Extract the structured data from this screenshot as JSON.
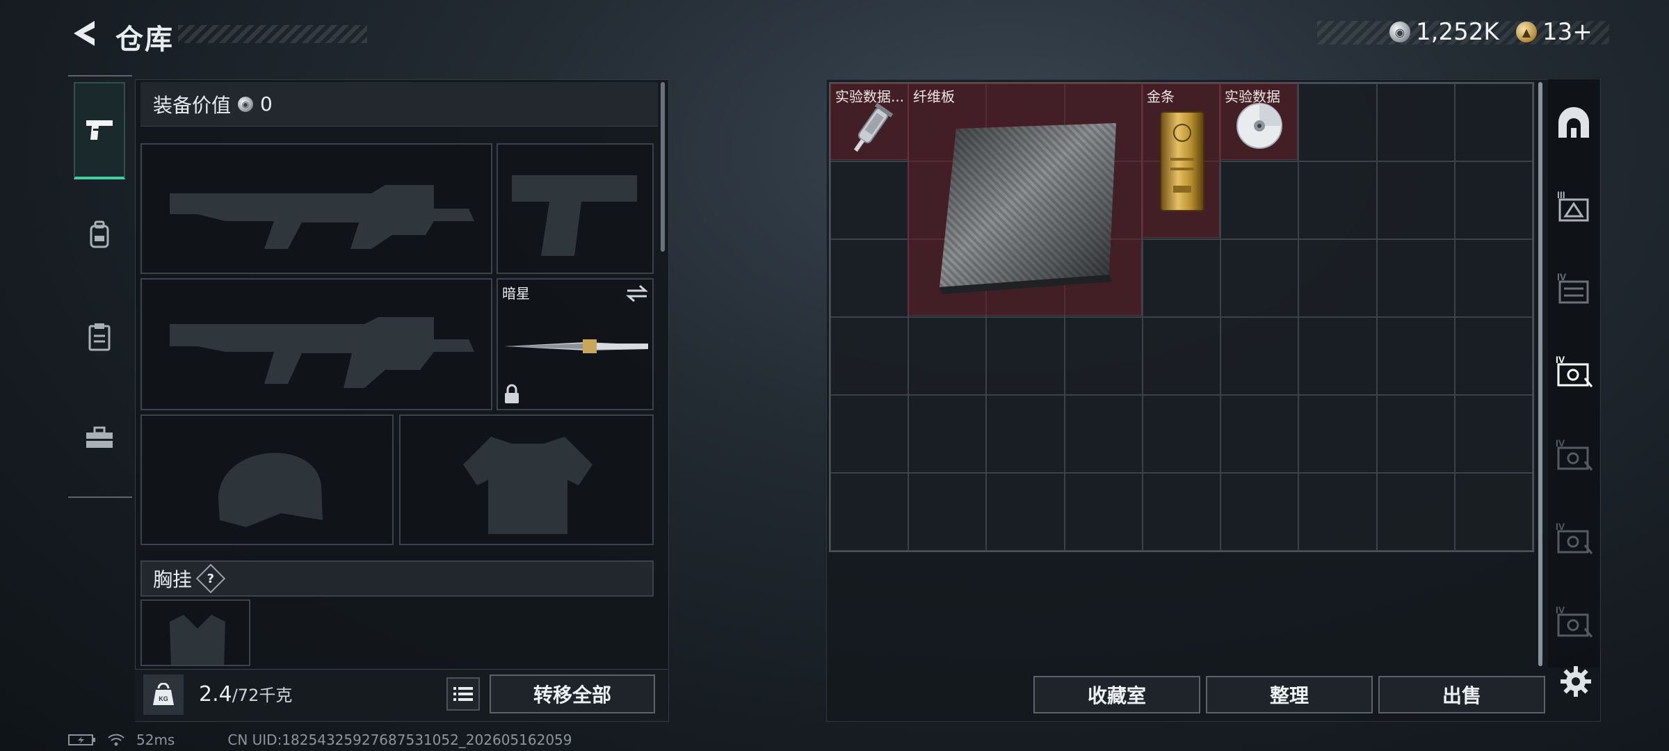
{
  "header": {
    "title": "仓库",
    "currency": [
      {
        "icon": "silver-coin-icon",
        "value": "1,252K"
      },
      {
        "icon": "gold-coin-icon",
        "value": "13+"
      }
    ]
  },
  "tabs": [
    {
      "name": "tab-weapons",
      "icon": "pistol-icon",
      "active": true
    },
    {
      "name": "tab-backpack",
      "icon": "backpack-icon",
      "active": false
    },
    {
      "name": "tab-clipboard",
      "icon": "clipboard-icon",
      "active": false
    },
    {
      "name": "tab-toolbox",
      "icon": "toolbox-icon",
      "active": false
    }
  ],
  "loadout": {
    "value_label": "装备价值",
    "value": "0",
    "knife_slot_label": "暗星",
    "chest_label": "胸挂",
    "chest_badge": "?",
    "weight_current": "2.4",
    "weight_max": "/72千克",
    "transfer_all": "转移全部"
  },
  "stash": {
    "items": [
      {
        "label": "实验数据...",
        "icon": "syringe-icon"
      },
      {
        "label": "纤维板",
        "icon": "fiberboard-icon"
      },
      {
        "label": "金条",
        "icon": "gold-bar-icon"
      },
      {
        "label": "实验数据",
        "icon": "data-disc-icon"
      }
    ],
    "buttons": {
      "collection": "收藏室",
      "organize": "整理",
      "sell": "出售"
    }
  },
  "sidebar_icons": [
    "home-vault-icon",
    "crate-III-icon",
    "crate-IV-icon",
    "crate-IV-active-icon",
    "crate-IV-icon",
    "crate-IV-icon",
    "crate-IV-icon"
  ],
  "status": {
    "ping": "52ms",
    "uid": "CN UID:18254325927687531052_202605162059"
  },
  "colors": {
    "accent": "#3fd0a0",
    "item_bg": "#6a2830",
    "panel": "#12161b"
  }
}
